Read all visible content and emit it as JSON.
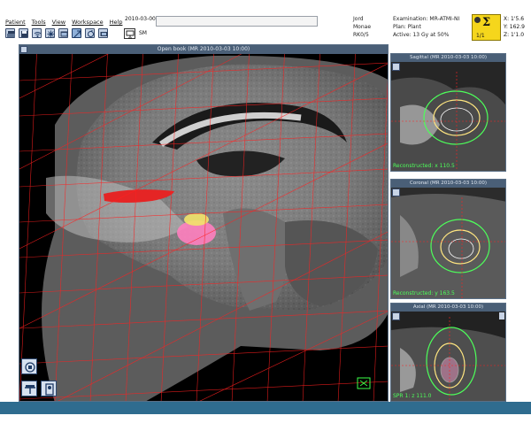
{
  "menu": {
    "items": [
      "Patient",
      "Tools",
      "View",
      "Workspace",
      "Help"
    ]
  },
  "toolbar": {
    "icons": [
      "print-icon",
      "save-icon",
      "wifi-icon",
      "snowflake-icon",
      "window-icon",
      "zoom-icon",
      "reset-icon",
      "film-icon"
    ]
  },
  "header": {
    "date_label": "2010-03-00",
    "sm_label": "SM"
  },
  "patient": {
    "line1": "Jord",
    "line2": "Monae",
    "line3": "RK0/5"
  },
  "plan": {
    "line1": "Examination: MR-ATMI-NI",
    "line2": "Plan: Plant",
    "line3": "Active: 13 Gy at 50%"
  },
  "sigma": {
    "symbol": "Σ",
    "fraction": "1/1"
  },
  "coords": {
    "x": "X: 1'5.6",
    "y": "Y: 162.9",
    "z": "Z: 1'1.0"
  },
  "main_view": {
    "title": "Open book (MR 2010-03-03 10:00)"
  },
  "panels": [
    {
      "title": "Sagittal (MR 2010-03-03 10:00)",
      "footer": "Reconstructed: x 110.5"
    },
    {
      "title": "Coronal (MR 2010-03-03 10:00)",
      "footer": "Reconstructed: y 163.5"
    },
    {
      "title": "Axial (MR 2010-03-03 10:00)",
      "footer": "SPR 1: z 111.0"
    }
  ],
  "colors": {
    "title_bar": "#4a5f77",
    "grid": "#ff2020",
    "isodose_green": "#4dff5a",
    "isodose_yellow": "#ffe680",
    "status_bar": "#2f6c8f",
    "sigma_bg": "#f5d61c"
  }
}
